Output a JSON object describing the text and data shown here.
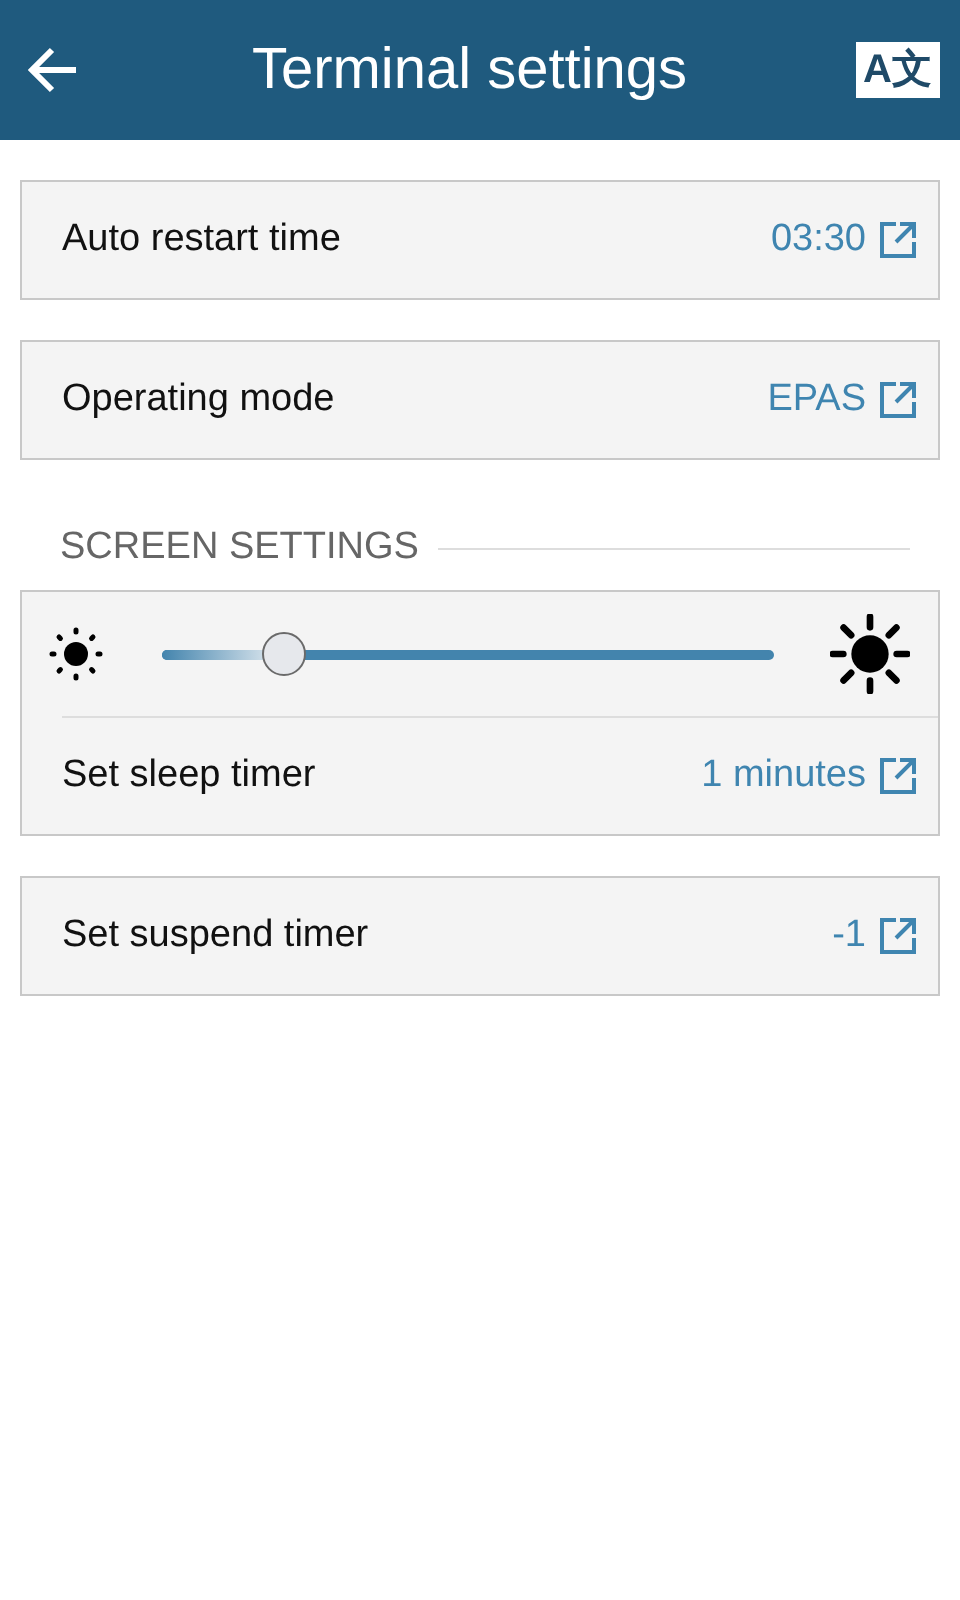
{
  "header": {
    "title": "Terminal settings",
    "language_label": "A文"
  },
  "items": [
    {
      "kind": "card",
      "rows": [
        {
          "kind": "link",
          "label": "Auto restart time",
          "value": "03:30"
        }
      ]
    },
    {
      "kind": "card",
      "rows": [
        {
          "kind": "link",
          "label": "Operating mode",
          "value": "EPAS"
        }
      ]
    },
    {
      "kind": "section",
      "title": "SCREEN SETTINGS"
    },
    {
      "kind": "card",
      "rows": [
        {
          "kind": "slider",
          "level": 0.2
        },
        {
          "kind": "link",
          "label": "Set sleep timer",
          "value": "1 minutes"
        }
      ]
    },
    {
      "kind": "card",
      "rows": [
        {
          "kind": "link",
          "label": "Set suspend timer",
          "value": "-1"
        }
      ]
    }
  ]
}
